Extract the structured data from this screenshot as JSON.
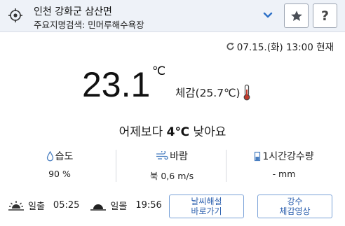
{
  "header": {
    "location_name": "인천 강화군 삼산면",
    "search_line": "주요지명검색: 민머루해수욕장",
    "favorite_icon": "star-icon",
    "help_label": "?"
  },
  "observation": {
    "time_text": "07.15.(화) 13:00 현재"
  },
  "current": {
    "temperature": "23.1",
    "unit": "℃",
    "feels_like_text": "체감(25.7℃)"
  },
  "comparison": {
    "prefix": "어제보다 ",
    "value": "4℃",
    "suffix": " 낮아요"
  },
  "stats": [
    {
      "label": "습도",
      "icon": "droplet-icon",
      "value": "90 %"
    },
    {
      "label": "바람",
      "icon": "wind-icon",
      "value": "북 0,6 m/s"
    },
    {
      "label": "1시간강수량",
      "icon": "rain-gauge-icon",
      "value": "- mm"
    }
  ],
  "sun": {
    "sunrise_label": "일출",
    "sunrise_time": "05:25",
    "sunset_label": "일몰",
    "sunset_time": "19:56"
  },
  "links": [
    {
      "line1": "날씨해설",
      "line2": "바로가기"
    },
    {
      "line1": "강수",
      "line2": "체감영상"
    }
  ],
  "colors": {
    "header_bg": "#eef2f8",
    "accent_blue": "#2b5fae",
    "thermo_red": "#c0392b"
  }
}
